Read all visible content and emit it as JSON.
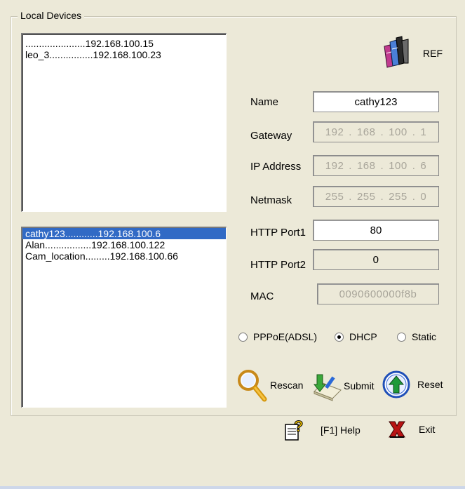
{
  "group_title": "Local Devices",
  "top_list": [
    "......................192.168.100.15",
    "leo_3................192.168.100.23"
  ],
  "bottom_list": [
    "cathy123............192.168.100.6",
    "Alan.................192.168.100.122",
    "Cam_location.........192.168.100.66"
  ],
  "selected_index": 0,
  "ref_label": "REF",
  "fields": {
    "name": {
      "label": "Name",
      "value": "cathy123"
    },
    "gateway": {
      "label": "Gateway",
      "segments": [
        "192",
        "168",
        "100",
        "1"
      ]
    },
    "ip": {
      "label": "IP Address",
      "segments": [
        "192",
        "168",
        "100",
        "6"
      ]
    },
    "netmask": {
      "label": "Netmask",
      "segments": [
        "255",
        "255",
        "255",
        "0"
      ]
    },
    "http1": {
      "label": "HTTP Port1",
      "value": "80"
    },
    "http2": {
      "label": "HTTP Port2",
      "value": "0"
    },
    "mac": {
      "label": "MAC",
      "value": "0090600000f8b"
    }
  },
  "radio": {
    "pppoe": "PPPoE(ADSL)",
    "dhcp": "DHCP",
    "static": "Static",
    "selected": "dhcp"
  },
  "buttons": {
    "rescan": "Rescan",
    "submit": "Submit",
    "reset": "Reset",
    "help": "[F1] Help",
    "exit": "Exit"
  },
  "icons": {
    "ref": "books-icon",
    "rescan": "magnifier-icon",
    "submit": "submit-arrow-icon",
    "reset": "up-arrow-circle-icon",
    "help": "help-icon",
    "exit": "exit-x-icon"
  }
}
